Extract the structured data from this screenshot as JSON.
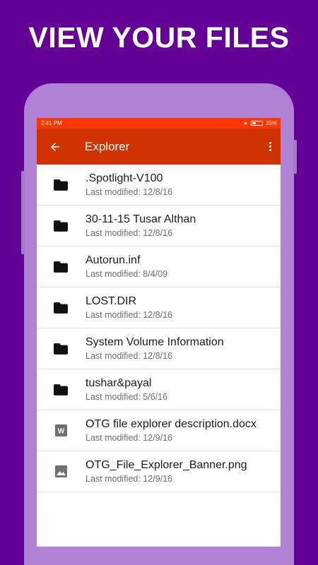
{
  "promo": {
    "headline": "VIEW YOUR FILES"
  },
  "status_bar": {
    "time": "2:41 PM",
    "battery_percent": "35%",
    "battery_level": 0.35
  },
  "app_bar": {
    "title": "Explorer",
    "back_icon": "arrow-back-icon",
    "menu_icon": "more-vert-icon"
  },
  "colors": {
    "background": "#650097",
    "status_bar": "#fe3702",
    "app_bar": "#d03301",
    "phone_frame": "#b181d6"
  },
  "files": [
    {
      "name": ".Spotlight-V100",
      "meta": "Last modified: 12/8/16",
      "icon": "folder-icon"
    },
    {
      "name": "30-11-15 Tusar Althan",
      "meta": "Last modified: 12/8/16",
      "icon": "folder-icon"
    },
    {
      "name": "Autorun.inf",
      "meta": "Last modified: 8/4/09",
      "icon": "folder-icon"
    },
    {
      "name": "LOST.DIR",
      "meta": "Last modified: 12/8/16",
      "icon": "folder-icon"
    },
    {
      "name": "System Volume Information",
      "meta": "Last modified: 12/8/16",
      "icon": "folder-icon"
    },
    {
      "name": "tushar&payal",
      "meta": "Last modified: 5/6/16",
      "icon": "folder-icon"
    },
    {
      "name": "OTG file explorer description.docx",
      "meta": "Last modified: 12/9/16",
      "icon": "word-doc-icon"
    },
    {
      "name": "OTG_File_Explorer_Banner.png",
      "meta": "Last modified: 12/9/16",
      "icon": "image-icon"
    }
  ]
}
